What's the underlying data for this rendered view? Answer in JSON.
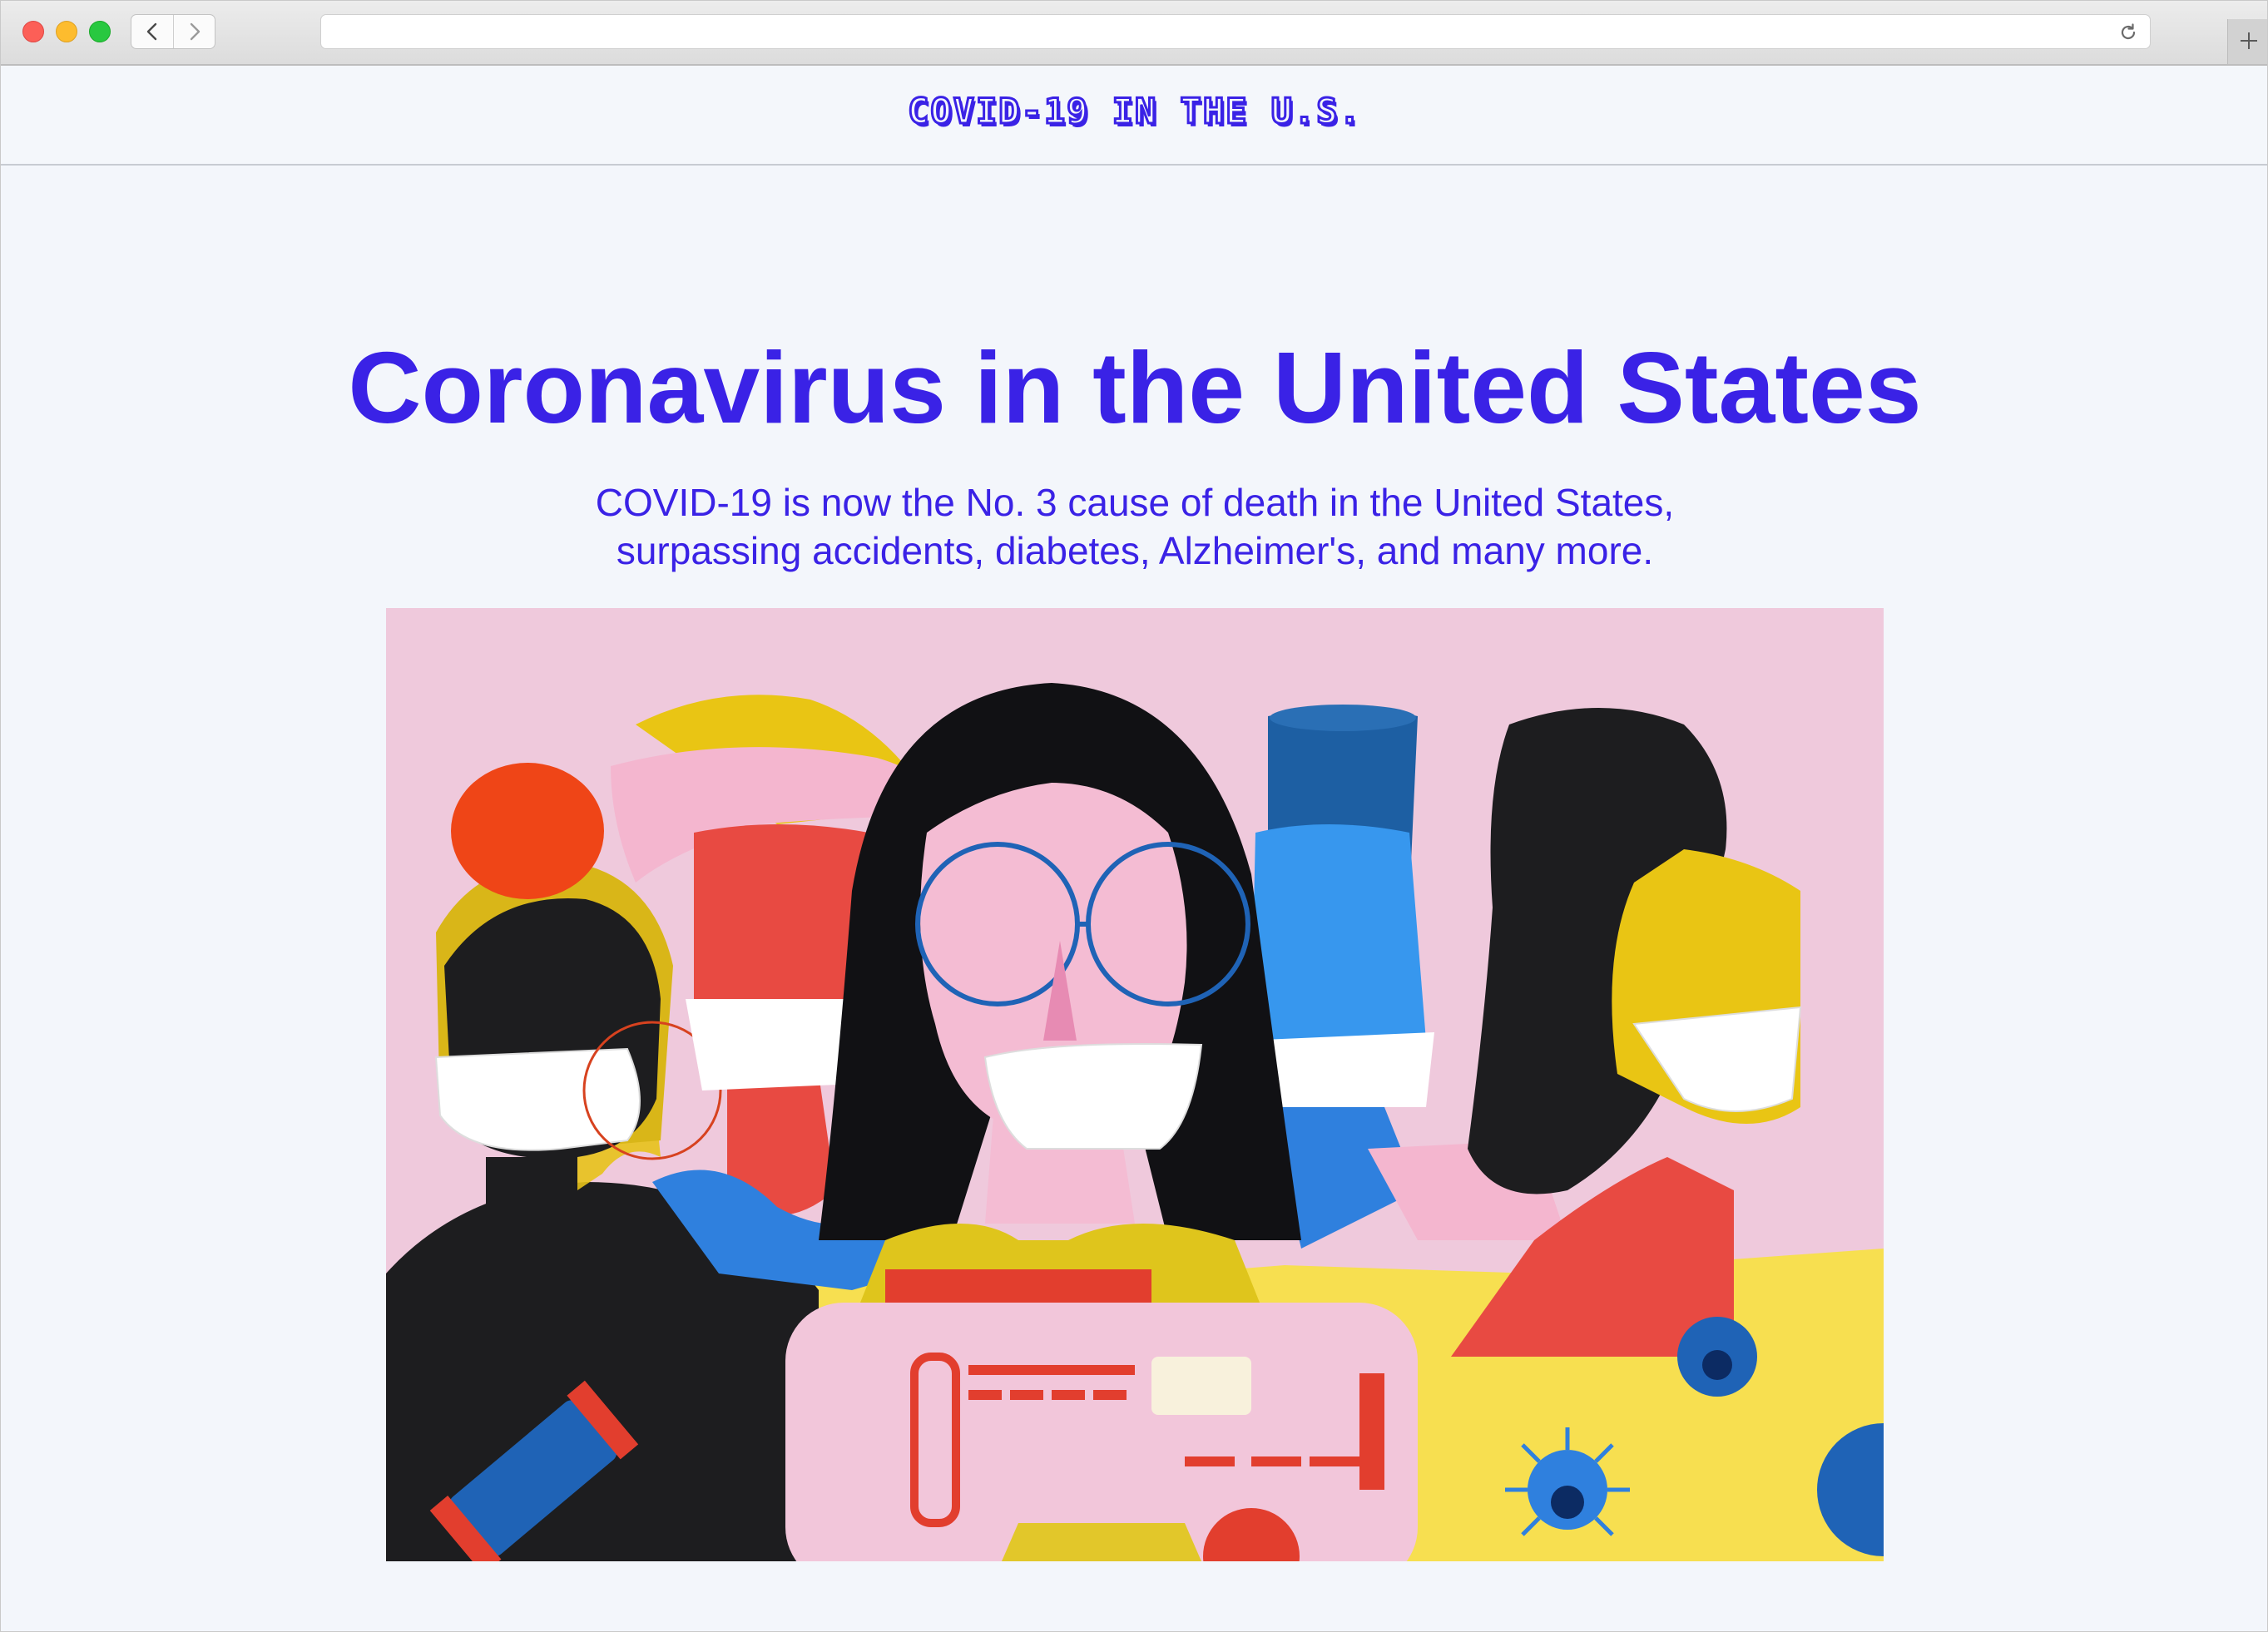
{
  "browser": {
    "url": "",
    "icons": [
      "back-arrow-icon",
      "forward-arrow-icon",
      "reload-icon",
      "plus-icon"
    ],
    "traffic_light_colors": [
      "#fc5f57",
      "#fdbc2e",
      "#28c840"
    ]
  },
  "header": {
    "logo_text": "COVID-19 IN THE U.S."
  },
  "hero": {
    "title": "Coronavirus in the United States",
    "subtitle_line1": "COVID-19 is now the No. 3 cause of death in the United States,",
    "subtitle_line2": "surpassing accidents, diabetes, Alzheimer's, and many more."
  },
  "theme": {
    "accent": "#3a22e6",
    "background": "#f3f6fb",
    "illustration_pink": "#efc9dc",
    "illustration_yellow": "#f7df50",
    "illustration_blue": "#2f80de",
    "illustration_red": "#e84a42"
  }
}
